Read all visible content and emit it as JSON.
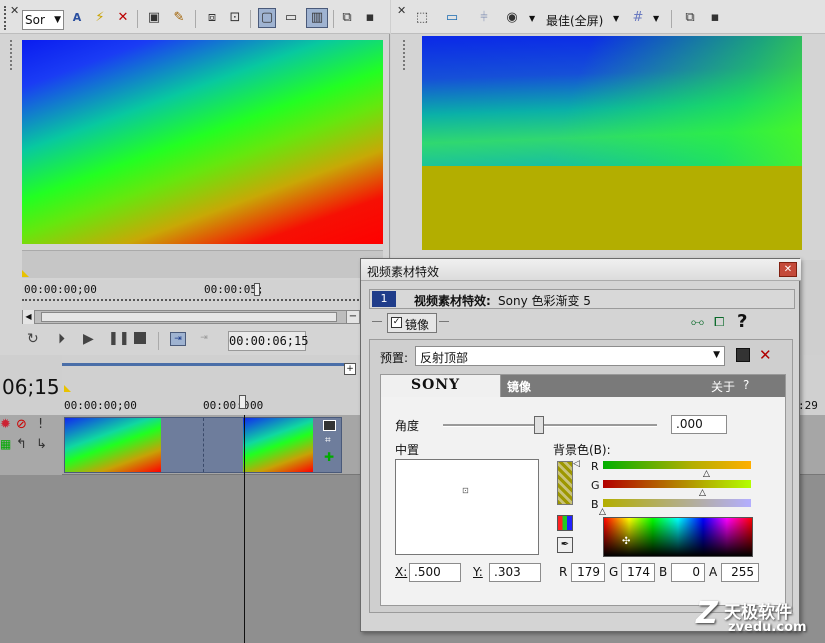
{
  "left_toolbar": {
    "dropdown_value": "Sor"
  },
  "right_toolbar": {
    "quality": "最佳(全屏)"
  },
  "trimmer": {
    "timecode_start": "00:00:00;00",
    "timecode_mark": "00:00:05;",
    "current_time": "00:00:06;15"
  },
  "timeline": {
    "big_time": "06;15",
    "ruler_start": "00:00:00;00",
    "ruler_mid": "00:00:0",
    "ruler_mid2": "00",
    "right_marker": ":29"
  },
  "dialog": {
    "title": "视频素材特效",
    "chain_index": "1",
    "chain_label": "视频素材特效:",
    "plugin_name": "Sony 色彩渐变 5",
    "tab_label": "镜像",
    "help": "?",
    "preset_label": "预置:",
    "preset_value": "反射顶部",
    "brand": "SONY",
    "section": "镜像",
    "about": "关于",
    "about_q": "?",
    "angle_label": "角度",
    "angle_value": ".000",
    "angle_fraction": 0.45,
    "center_label": "中置",
    "bg_label": "背景色(B):",
    "x_label": "X:",
    "x_value": ".500",
    "y_label": "Y:",
    "y_value": ".303",
    "r_label": "R",
    "r_value": "179",
    "g_label": "G",
    "g_value": "174",
    "b_label": "B",
    "b_value": "0",
    "a_label": "A",
    "a_value": "255",
    "ch_r": "R",
    "ch_g": "G",
    "ch_b": "B"
  },
  "watermark": {
    "text1": "Z",
    "text2": "天极软件",
    "text3": "zvedu.com"
  },
  "colors": {
    "accent": "#4a6ea8",
    "mirror_yellow": "#b3ae00"
  }
}
